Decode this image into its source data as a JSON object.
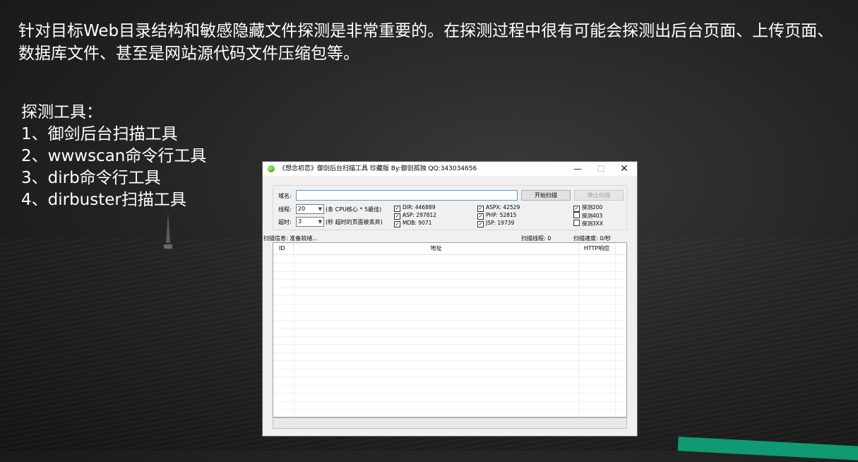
{
  "slide": {
    "intro_text": "针对目标Web目录结构和敏感隐藏文件探测是非常重要的。在探测过程中很有可能会探测出后台页面、上传页面、数据库文件、甚至是网站源代码文件压缩包等。",
    "tools_heading": "探测工具：",
    "tools": [
      "1、御剑后台扫描工具",
      "2、wwwscan命令行工具",
      "3、dirb命令行工具",
      "4、dirbuster扫描工具"
    ]
  },
  "window": {
    "title": "《想念初恋》御剑后台扫描工具 珍藏版 By:御剑孤独 QQ:343034656",
    "min": "—",
    "max": "☐",
    "close": "✕",
    "domain_label": "域名:",
    "domain_value": "",
    "start_button": "开始扫描",
    "stop_button": "停止扫描",
    "threads_label": "线程:",
    "threads_value": "20",
    "threads_hint": "(条 CPU核心 * 5最佳)",
    "timeout_label": "超时:",
    "timeout_value": "3",
    "timeout_hint": "(秒 超时的页面被丢弃)",
    "dicts": [
      {
        "label": "DIR: 446889",
        "checked": true
      },
      {
        "label": "ASP: 297812",
        "checked": true
      },
      {
        "label": "MDB: 9071",
        "checked": true
      },
      {
        "label": "ASPX: 42529",
        "checked": true
      },
      {
        "label": "PHP: 52815",
        "checked": true
      },
      {
        "label": "JSP: 19739",
        "checked": true
      }
    ],
    "probes": [
      {
        "label": "探测200",
        "checked": true
      },
      {
        "label": "探测403",
        "checked": false
      },
      {
        "label": "探测3XX",
        "checked": false
      }
    ],
    "scan_info": "扫描信息: 准备就绪...",
    "scan_threads": "扫描线程: 0",
    "scan_speed": "扫描速度: 0/秒",
    "columns": {
      "id": "ID",
      "address": "地址",
      "http": "HTTP响应"
    }
  }
}
